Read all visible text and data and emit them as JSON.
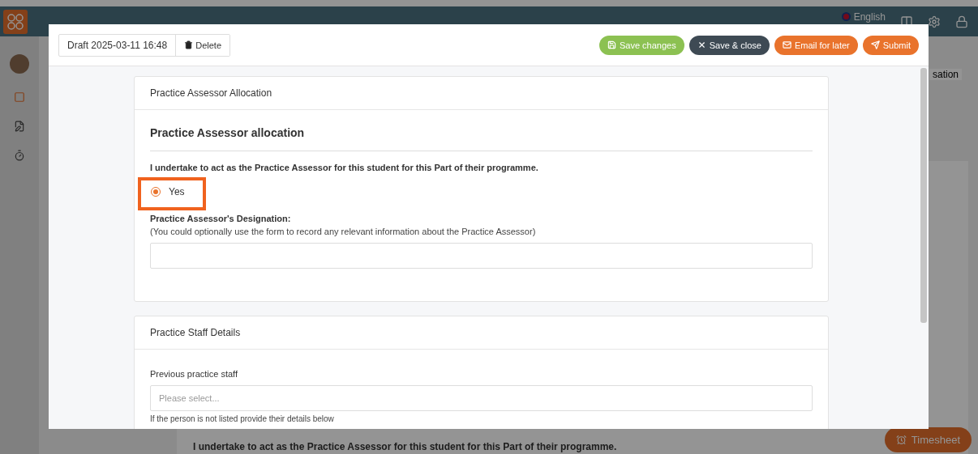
{
  "app": {
    "language": "English",
    "side_text": "sation",
    "timesheet": "Timesheet",
    "background_question": "I undertake to act as the Practice Assessor for this student for this Part of their programme."
  },
  "modal": {
    "draft_label": "Draft 2025-03-11 16:48",
    "delete": "Delete",
    "actions": [
      {
        "label": "Save changes",
        "kind": "save"
      },
      {
        "label": "Save & close",
        "kind": "close"
      },
      {
        "label": "Email for later",
        "kind": "email"
      },
      {
        "label": "Submit",
        "kind": "submit"
      }
    ]
  },
  "allocation_section": {
    "title": "Practice Assessor Allocation",
    "heading": "Practice Assessor allocation",
    "question": "I undertake to act as the Practice Assessor for this student for this Part of their programme.",
    "options": [
      {
        "label": "Yes",
        "selected": true,
        "highlighted": true
      }
    ],
    "designation_label": "Practice Assessor's Designation:",
    "designation_hint": "(You could optionally use the form to record any relevant information about the Practice Assessor)"
  },
  "staff_section": {
    "title": "Practice Staff Details",
    "field_label": "Previous practice staff",
    "placeholder": "Please select...",
    "help": "If the person is not listed provide their details below"
  }
}
